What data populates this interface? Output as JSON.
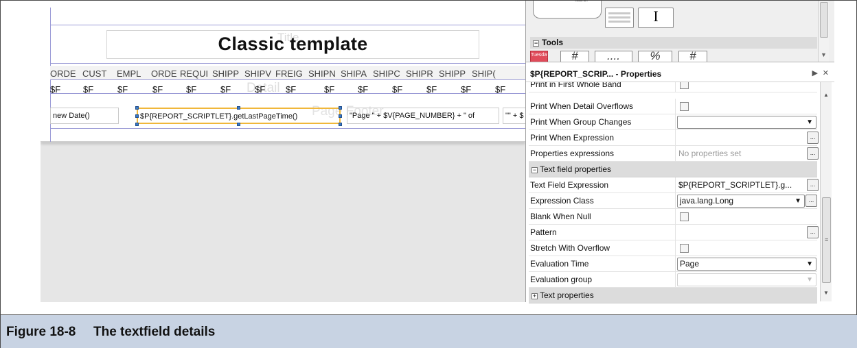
{
  "designer": {
    "title_ghost": "Title",
    "title": "Classic template",
    "column_headers": [
      "ORDE",
      "CUST",
      "EMPL",
      "ORDE",
      "REQUI",
      "SHIPP",
      "SHIPV",
      "FREIG",
      "SHIPN",
      "SHIPA",
      "SHIPC",
      "SHIPR",
      "SHIPP",
      "SHIP("
    ],
    "field_markers": [
      "$F",
      "$F",
      "$F",
      "$F",
      "$F",
      "$F",
      "$F",
      "$F",
      "$F",
      "$F",
      "$F",
      "$F",
      "$F",
      "$F"
    ],
    "detail_ghost": "Detail",
    "footer_ghost": "Page Footer",
    "footer_fields": {
      "date": "new Date()",
      "selected": "$P{REPORT_SCRIPTLET}.getLastPageTime()",
      "page": "\"Page \" + $V{PAGE_NUMBER} + \" of",
      "more": "\"\" + $"
    }
  },
  "palette": {
    "label_icon": "label",
    "tools_title": "Tools",
    "calendar_text": "Tuesday",
    "tool_glyphs": [
      "#",
      "....",
      "%",
      "#"
    ]
  },
  "properties": {
    "title": "$P{REPORT_SCRIP... - Properties",
    "maximize_glyph": "▶",
    "close_glyph": "✕",
    "cut_row_name": "Print in First Whole Band",
    "rows": [
      {
        "name": "Print When Detail Overflows",
        "type": "checkbox"
      },
      {
        "name": "Print When Group Changes",
        "type": "combo",
        "value": ""
      },
      {
        "name": "Print When Expression",
        "type": "button",
        "value": ""
      },
      {
        "name": "Properties expressions",
        "type": "button",
        "value": "No properties set",
        "placeholder": true
      }
    ],
    "section_text_field": "Text field properties",
    "text_field_rows": [
      {
        "name": "Text Field Expression",
        "type": "button",
        "value": "$P{REPORT_SCRIPTLET}.g..."
      },
      {
        "name": "Expression Class",
        "type": "combo-button",
        "value": "java.lang.Long"
      },
      {
        "name": "Blank When Null",
        "type": "checkbox"
      },
      {
        "name": "Pattern",
        "type": "button",
        "value": ""
      },
      {
        "name": "Stretch With Overflow",
        "type": "checkbox"
      },
      {
        "name": "Evaluation Time",
        "type": "combo",
        "value": "Page"
      },
      {
        "name": "Evaluation group",
        "type": "combo-disabled",
        "value": ""
      }
    ],
    "section_text": "Text properties",
    "ellipsis": "..."
  },
  "caption": {
    "label": "Figure 18-8",
    "title": "The textfield details"
  }
}
